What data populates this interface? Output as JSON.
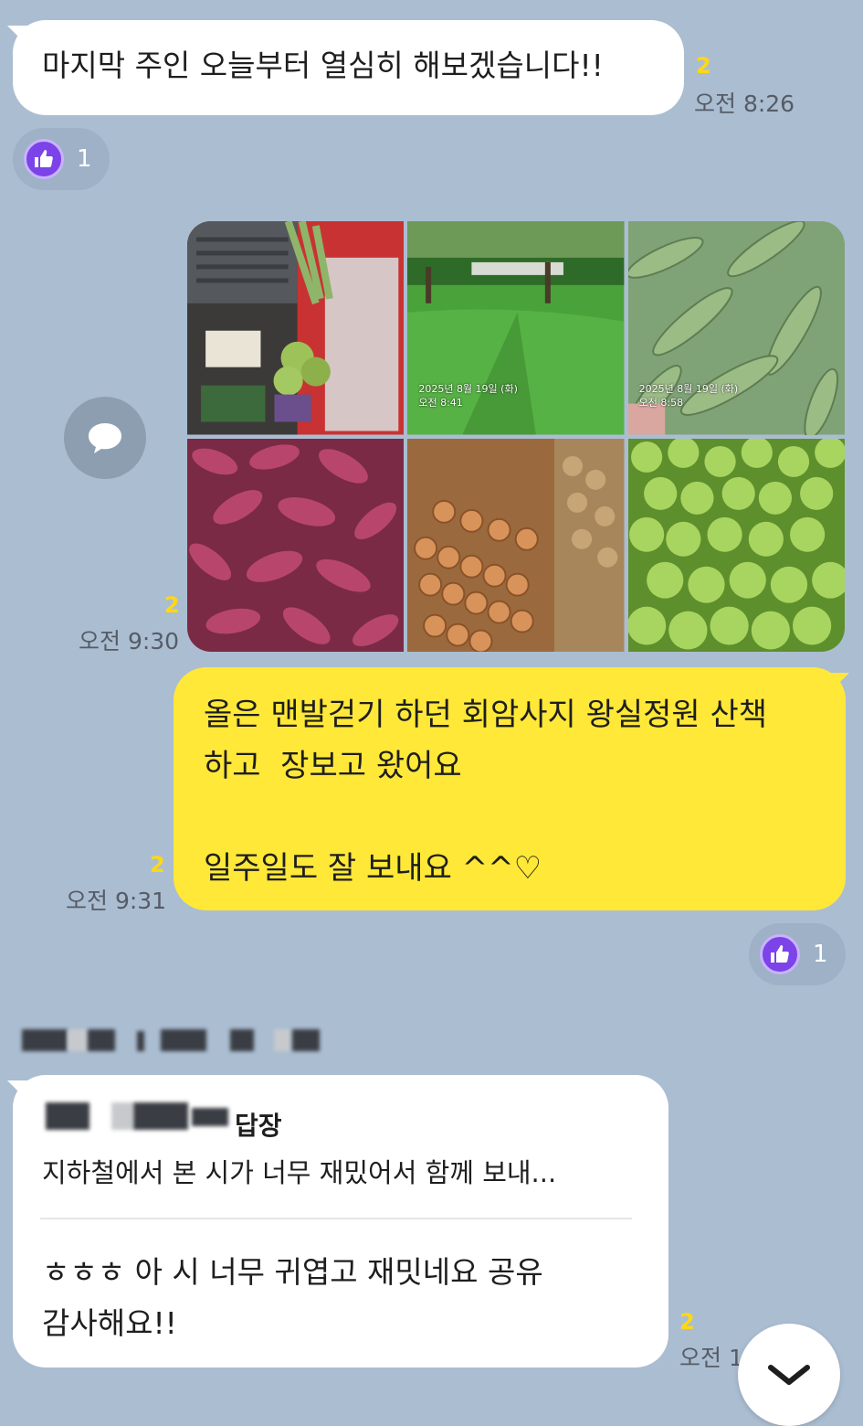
{
  "messages": {
    "m1": {
      "text": "마지막 주인 오늘부터 열심히 해보겠습니다!!",
      "unread": "2",
      "time": "오전 8:26",
      "reaction_count": "1"
    },
    "m2": {
      "unread": "2",
      "time": "오전 9:30",
      "photos": [
        {
          "kind": "groceries"
        },
        {
          "kind": "garden",
          "stamp": "2025년 8월 19일 (화)\n오전 8:41"
        },
        {
          "kind": "corn",
          "stamp": "2025년 8월 19일 (화)\n오전 8:58"
        },
        {
          "kind": "sweet-potatoes"
        },
        {
          "kind": "carrots-potatoes"
        },
        {
          "kind": "green-apples"
        }
      ]
    },
    "m3": {
      "text": "올은 맨발걷기 하던 회암사지 왕실정원 산책\n하고  장보고 왔어요\n\n일주일도 잘 보내요 ^^♡",
      "unread": "2",
      "time": "오전 9:31",
      "reaction_count": "1"
    },
    "m4": {
      "reply_label": "답장",
      "quoted": "지하철에서 본 시가 너무 재밌어서 함께 보내...",
      "text": "ㅎㅎㅎ 아 시 너무 귀엽고 재밋네요 공유\n감사해요!!",
      "unread": "2",
      "time": "오전 11:14"
    }
  },
  "icons": {
    "reaction": "thumbs-up-icon",
    "share": "speech-bubble-icon",
    "scroll": "chevron-down-icon"
  },
  "colors": {
    "background": "#abbdd1",
    "my_bubble": "#ffe838",
    "other_bubble": "#ffffff",
    "unread": "#ffd814",
    "reaction": "#7b43e8"
  }
}
